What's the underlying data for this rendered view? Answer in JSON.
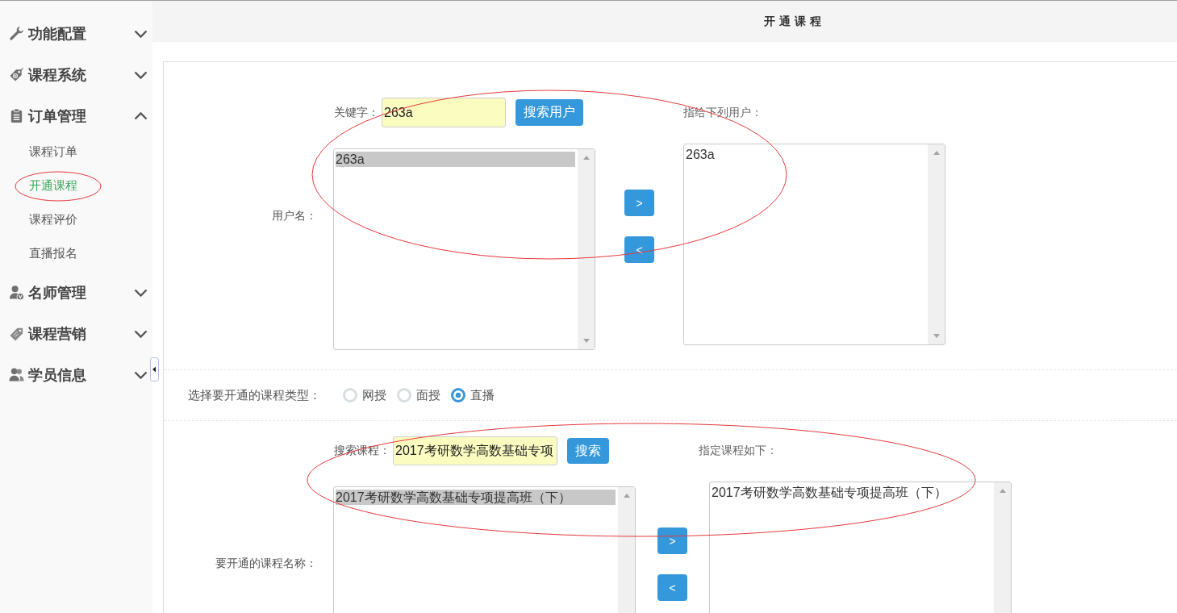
{
  "sidebar": {
    "groups": [
      {
        "title": "功能配置",
        "expanded": false
      },
      {
        "title": "课程系统",
        "expanded": false
      },
      {
        "title": "订单管理",
        "expanded": true,
        "items": [
          {
            "label": "课程订单",
            "selected": false
          },
          {
            "label": "开通课程",
            "selected": true
          },
          {
            "label": "课程评价",
            "selected": false
          },
          {
            "label": "直播报名",
            "selected": false
          }
        ]
      },
      {
        "title": "名师管理",
        "expanded": false
      },
      {
        "title": "课程营销",
        "expanded": false
      },
      {
        "title": "学员信息",
        "expanded": false
      }
    ]
  },
  "header": {
    "title": "开通课程"
  },
  "user_section": {
    "search_label": "关键字：",
    "search_value": "263a",
    "search_button": "搜索用户",
    "field_label": "用户名：",
    "source_list": [
      {
        "text": "263a",
        "selected": true
      }
    ],
    "move_buttons": [
      ">",
      "<"
    ],
    "target_label": "指给下列用户：",
    "target_list": [
      {
        "text": "263a",
        "selected": false
      }
    ]
  },
  "course_type": {
    "label": "选择要开通的课程类型：",
    "options": [
      {
        "label": "网授",
        "selected": false
      },
      {
        "label": "面授",
        "selected": false
      },
      {
        "label": "直播",
        "selected": true
      }
    ]
  },
  "course_section": {
    "search_label": "搜索课程：",
    "search_value": "2017考研数学高数基础专项",
    "search_button": "搜索",
    "field_label": "要开通的课程名称：",
    "source_list": [
      {
        "text": "2017考研数学高数基础专项提高班（下）",
        "selected": true
      }
    ],
    "move_buttons": [
      ">",
      "<"
    ],
    "target_label": "指定课程如下：",
    "target_list": [
      {
        "text": "2017考研数学高数基础专项提高班（下）",
        "selected": false
      }
    ]
  }
}
